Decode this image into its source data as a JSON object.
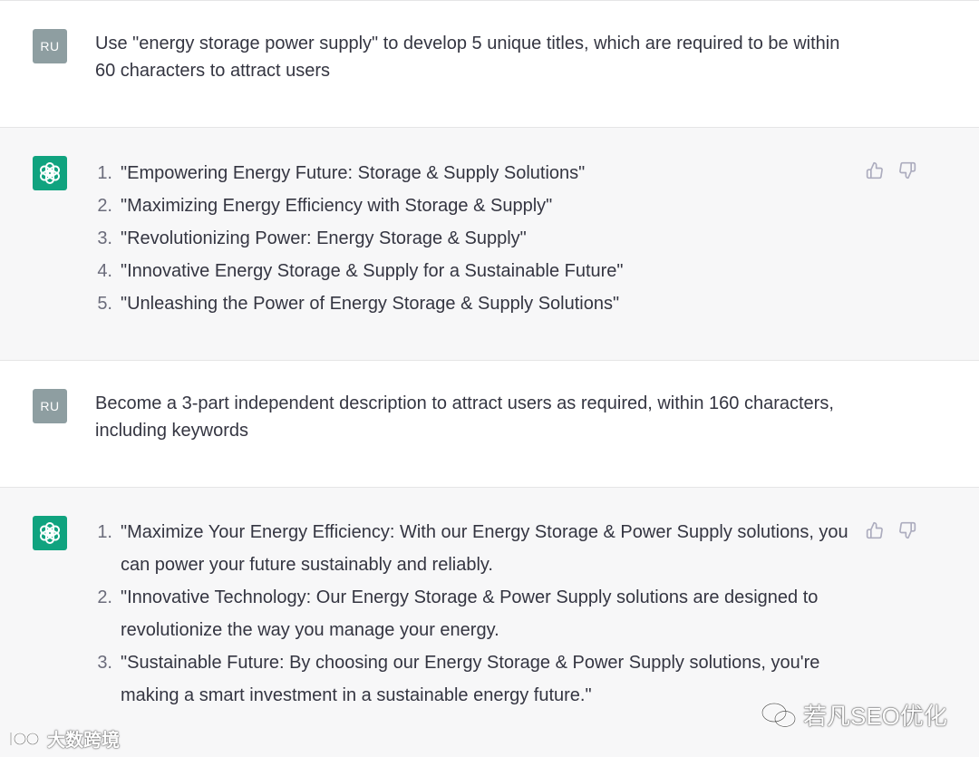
{
  "messages": [
    {
      "role": "user",
      "avatar_label": "RU",
      "text": "Use \"energy storage power supply\" to develop 5 unique titles, which are required to be within 60 characters to attract users"
    },
    {
      "role": "assistant",
      "avatar_icon": "openai-logo-icon",
      "items": [
        {
          "num": "1.",
          "text": "\"Empowering Energy Future: Storage & Supply Solutions\""
        },
        {
          "num": "2.",
          "text": "\"Maximizing Energy Efficiency with Storage & Supply\""
        },
        {
          "num": "3.",
          "text": "\"Revolutionizing Power: Energy Storage & Supply\""
        },
        {
          "num": "4.",
          "text": "\"Innovative Energy Storage & Supply for a Sustainable Future\""
        },
        {
          "num": "5.",
          "text": "\"Unleashing the Power of Energy Storage & Supply Solutions\""
        }
      ]
    },
    {
      "role": "user",
      "avatar_label": "RU",
      "text": "Become a 3-part independent description to attract users as required, within 160 characters, including keywords"
    },
    {
      "role": "assistant",
      "avatar_icon": "openai-logo-icon",
      "items": [
        {
          "num": "1.",
          "text": "\"Maximize Your Energy Efficiency: With our Energy Storage & Power Supply solutions, you can power your future sustainably and reliably."
        },
        {
          "num": "2.",
          "text": "\"Innovative Technology: Our Energy Storage & Power Supply solutions are designed to revolutionize the way you manage your energy."
        },
        {
          "num": "3.",
          "text": "\"Sustainable Future: By choosing our Energy Storage & Power Supply solutions, you're making a smart investment in a sustainable energy future.\""
        }
      ]
    }
  ],
  "feedback": {
    "thumbs_up_icon": "thumbs-up-icon",
    "thumbs_down_icon": "thumbs-down-icon"
  },
  "watermarks": {
    "left": "大数跨境",
    "right": "若凡SEO优化"
  },
  "colors": {
    "user_bg": "#ffffff",
    "assistant_bg": "#f7f7f8",
    "user_avatar": "#8e9ea1",
    "assistant_avatar": "#10a37f",
    "text": "#343541",
    "icon": "#acacbe"
  }
}
